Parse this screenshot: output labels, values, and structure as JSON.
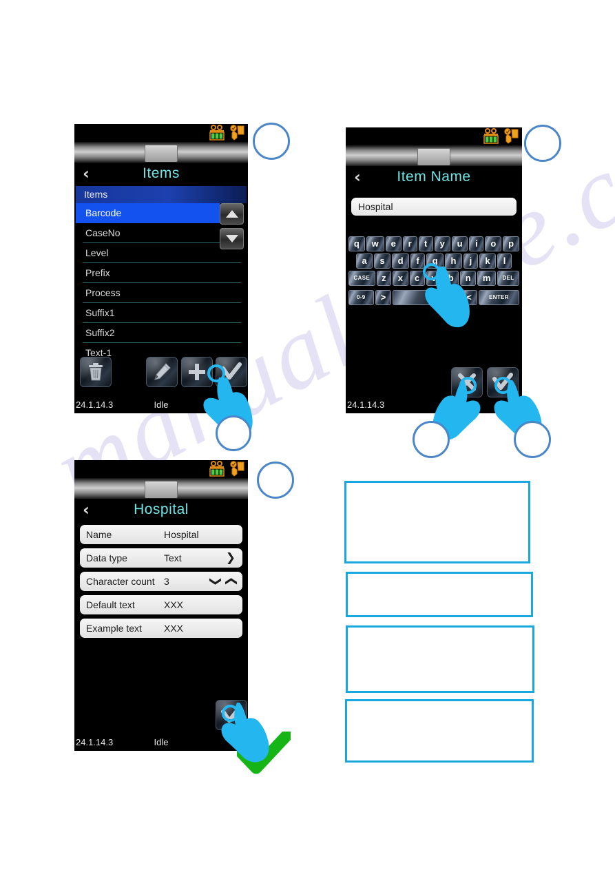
{
  "watermark": {
    "text": "manualshive.com"
  },
  "panel_items": {
    "title": "Items",
    "back_label": "‹",
    "status_icons": [
      "battery-icon",
      "printer-icon"
    ],
    "list_header": "Items",
    "rows": [
      {
        "label": "Barcode",
        "selected": true
      },
      {
        "label": "CaseNo",
        "selected": false
      },
      {
        "label": "Level",
        "selected": false
      },
      {
        "label": "Prefix",
        "selected": false
      },
      {
        "label": "Process",
        "selected": false
      },
      {
        "label": "Suffix1",
        "selected": false
      },
      {
        "label": "Suffix2",
        "selected": false
      },
      {
        "label": "Text-1",
        "selected": false
      }
    ],
    "scroll_up": "▲",
    "scroll_down": "▼",
    "toolbar": [
      {
        "name": "delete-button",
        "icon": "trash-icon"
      },
      {
        "name": "edit-button",
        "icon": "pencil-icon"
      },
      {
        "name": "add-button",
        "icon": "plus-icon"
      },
      {
        "name": "confirm-button",
        "icon": "check-icon"
      }
    ],
    "footer": {
      "version": "24.1.14.3",
      "status": "Idle"
    }
  },
  "panel_item_name": {
    "title": "Item Name",
    "back_label": "‹",
    "input_value": "Hospital",
    "keyboard": {
      "row1": [
        "q",
        "w",
        "e",
        "r",
        "t",
        "y",
        "u",
        "i",
        "o",
        "p"
      ],
      "row2": [
        "a",
        "s",
        "d",
        "f",
        "g",
        "h",
        "j",
        "k",
        "l"
      ],
      "row3": [
        "CASE",
        "z",
        "x",
        "c",
        "v",
        "b",
        "n",
        "m",
        "DEL"
      ],
      "row4": [
        "0-9",
        ">",
        " ",
        "<",
        "ENTER"
      ]
    },
    "toolbar": [
      {
        "name": "cancel-button",
        "icon": "x-icon"
      },
      {
        "name": "confirm-button",
        "icon": "check-icon"
      }
    ],
    "footer": {
      "version": "24.1.14.3",
      "status": ""
    }
  },
  "panel_hospital": {
    "title": "Hospital",
    "back_label": "‹",
    "rows": [
      {
        "label": "Name",
        "value": "Hospital",
        "control": "none"
      },
      {
        "label": "Data type",
        "value": "Text",
        "control": "chevron-right"
      },
      {
        "label": "Character count",
        "value": "3",
        "control": "stepper"
      },
      {
        "label": "Default text",
        "value": "XXX",
        "control": "none"
      },
      {
        "label": "Example text",
        "value": "XXX",
        "control": "none"
      }
    ],
    "chevron_right": "❯",
    "stepper_down": "❯",
    "stepper_up": "❯",
    "toolbar": [
      {
        "name": "confirm-button",
        "icon": "check-icon"
      }
    ],
    "footer": {
      "version": "24.1.14.3",
      "status": "Idle"
    }
  },
  "step_circles": [
    {
      "name": "step-circle-1",
      "label": ""
    },
    {
      "name": "step-circle-2",
      "label": ""
    },
    {
      "name": "step-circle-3",
      "label": ""
    },
    {
      "name": "step-circle-4",
      "label": ""
    },
    {
      "name": "step-circle-5",
      "label": ""
    },
    {
      "name": "step-circle-6",
      "label": ""
    }
  ],
  "callouts": [
    {
      "name": "callout-box-1",
      "text": ""
    },
    {
      "name": "callout-box-2",
      "text": ""
    },
    {
      "name": "callout-box-3",
      "text": ""
    },
    {
      "name": "callout-box-4",
      "text": ""
    }
  ],
  "colors": {
    "accent_cyan": "#19a8dd",
    "hand_cyan": "#24b6ef",
    "circle_blue": "#4a86c8",
    "title_cyan": "#6fe4e4",
    "selected_blue": "#1452f0",
    "header_blue": "#1c40ae",
    "green_check": "#16b416"
  }
}
